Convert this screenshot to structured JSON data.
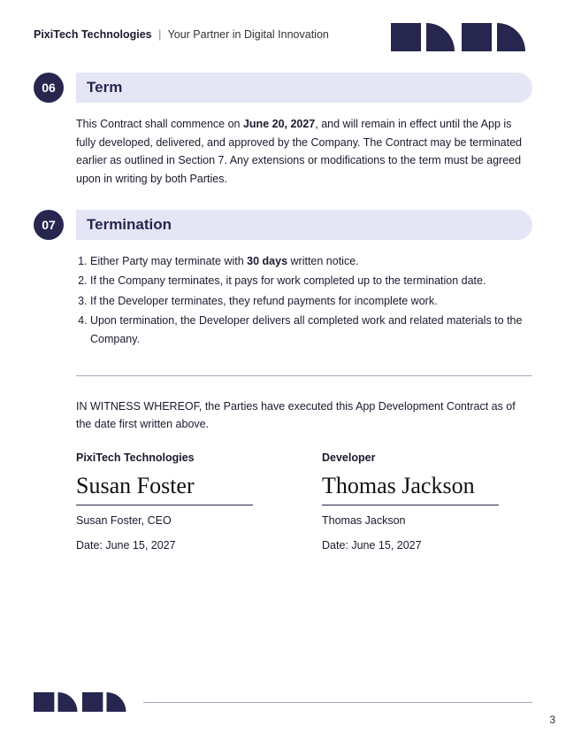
{
  "header": {
    "company": "PixiTech Technologies",
    "tagline": "Your Partner in Digital Innovation"
  },
  "sections": {
    "s06": {
      "num": "06",
      "title": "Term",
      "body_pre": "This Contract shall commence on ",
      "body_bold": "June 20, 2027",
      "body_post": ", and will remain in effect until the App is fully developed, delivered, and approved by the Company. The Contract may be terminated earlier as outlined in Section 7. Any extensions or modifications to the term must be agreed upon in writing by both Parties."
    },
    "s07": {
      "num": "07",
      "title": "Termination",
      "items": {
        "i1_pre": "Either Party may terminate with ",
        "i1_bold": "30 days",
        "i1_post": " written notice.",
        "i2": "If the Company terminates, it pays for work completed up to the termination date.",
        "i3": "If the Developer terminates, they refund payments for incomplete work.",
        "i4": "Upon termination, the Developer delivers all completed work and related materials to the Company."
      }
    }
  },
  "witness": "IN WITNESS WHEREOF, the Parties have executed this App Development Contract as of the date first written above.",
  "signatures": {
    "left": {
      "party": "PixiTech Technologies",
      "signature": "Susan Foster",
      "name": "Susan Foster, CEO",
      "date": "Date: June  15, 2027"
    },
    "right": {
      "party": "Developer",
      "signature": "Thomas Jackson",
      "name": "Thomas Jackson",
      "date": "Date: June  15, 2027"
    }
  },
  "page": "3"
}
